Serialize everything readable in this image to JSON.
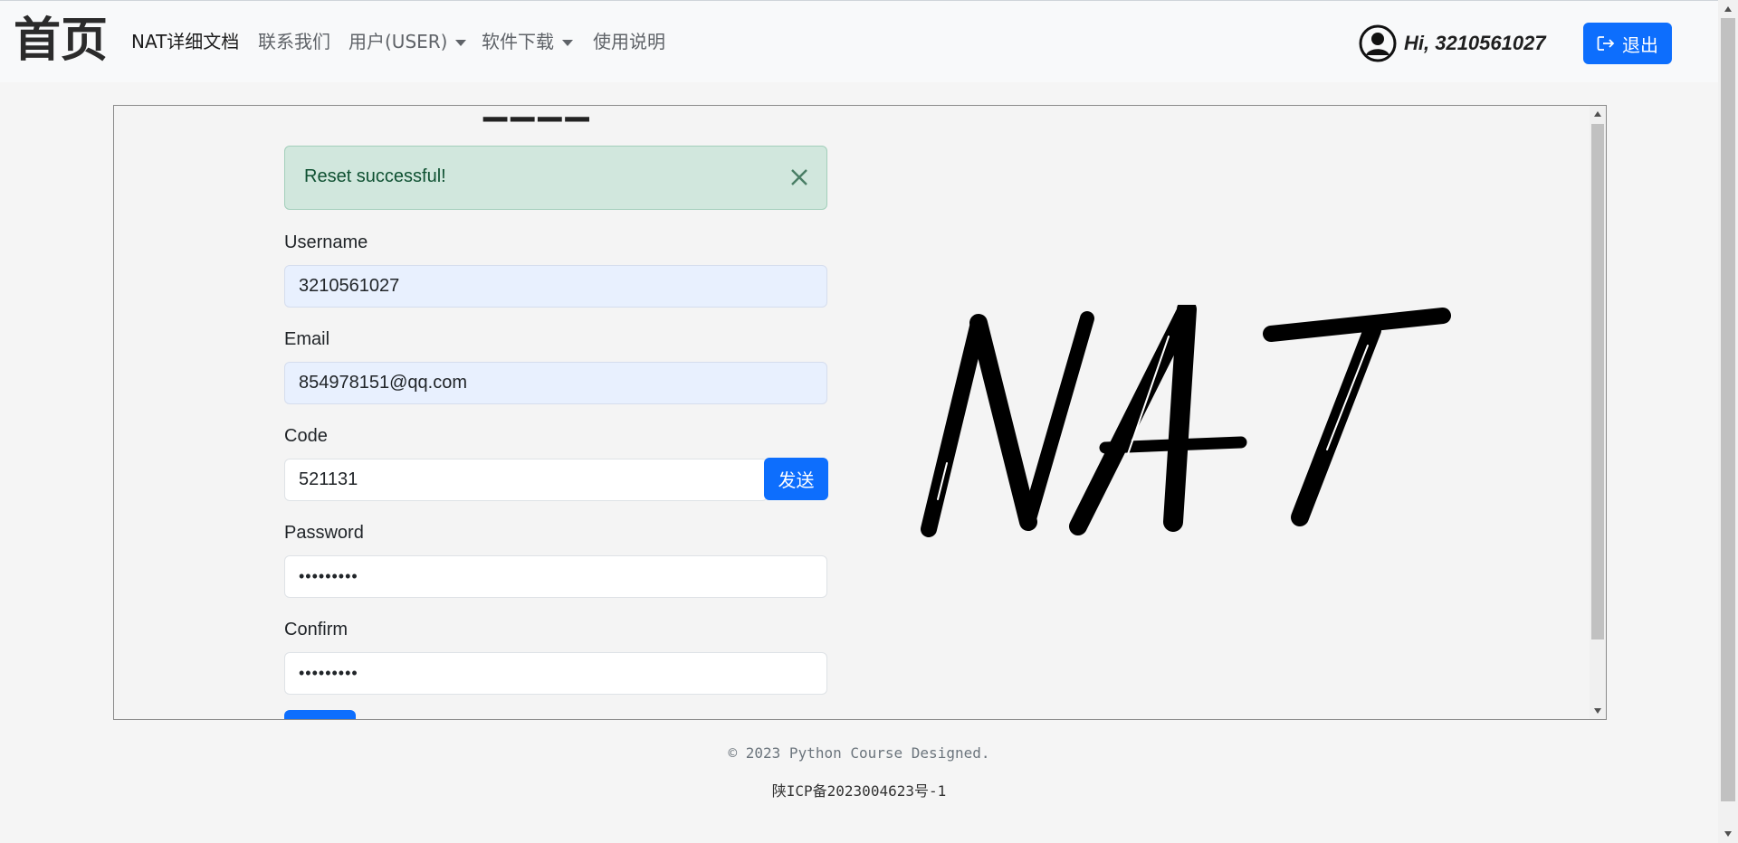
{
  "navbar": {
    "brand": "首页",
    "links": [
      {
        "label": "NAT详细文档",
        "dropdown": false,
        "active": true
      },
      {
        "label": "联系我们",
        "dropdown": false
      },
      {
        "label": "用户(USER)",
        "dropdown": true
      },
      {
        "label": "软件下载",
        "dropdown": true
      },
      {
        "label": "使用说明",
        "dropdown": false
      }
    ],
    "greeting": "Hi, 3210561027",
    "logout_label": "退出"
  },
  "form": {
    "alert": "Reset successful!",
    "username_label": "Username",
    "username_value": "3210561027",
    "email_label": "Email",
    "email_value": "854978151@qq.com",
    "code_label": "Code",
    "code_value": "521131",
    "send_label": "发送",
    "password_label": "Password",
    "password_value": "•••••••••",
    "confirm_label": "Confirm",
    "confirm_value": "•••••••••"
  },
  "logo_text": "NAT",
  "footer": {
    "copyright": "© 2023 Python Course Designed.",
    "icp": "陕ICP备2023004623号-1"
  },
  "colors": {
    "primary": "#0d6efd",
    "alert_bg": "#d1e7dd",
    "alert_text": "#0f5132",
    "autofill_bg": "#e8f0fe"
  }
}
